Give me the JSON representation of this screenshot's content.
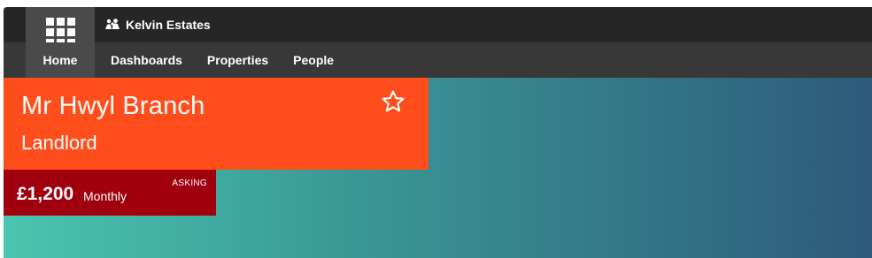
{
  "app": {
    "brand_name": "Kelvin Estates",
    "brand_icon": "people-group-icon",
    "apps_icon": "apps-grid-icon"
  },
  "nav": {
    "items": [
      {
        "label": "Home",
        "active": true
      },
      {
        "label": "Dashboards"
      },
      {
        "label": "Properties"
      },
      {
        "label": "People"
      }
    ]
  },
  "hero": {
    "title": "Mr Hwyl Branch",
    "subtitle": "Landlord",
    "favorite_icon": "star-outline-icon"
  },
  "price": {
    "value": "£1,200",
    "period": "Monthly",
    "tag": "ASKING"
  },
  "colors": {
    "topbar": "#262626",
    "navbar": "#383838",
    "hero_card": "#ff4e1c",
    "price_card": "#a0000e",
    "gradient_start": "#4ac5b0",
    "gradient_end": "#2d5a7b"
  }
}
